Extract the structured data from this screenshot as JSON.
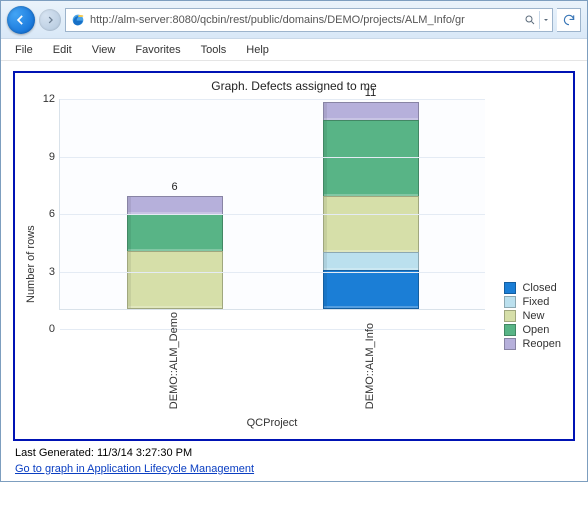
{
  "browser": {
    "url": "http://alm-server:8080/qcbin/rest/public/domains/DEMO/projects/ALM_Info/gr",
    "menu": {
      "file": "File",
      "edit": "Edit",
      "view": "View",
      "favorites": "Favorites",
      "tools": "Tools",
      "help": "Help"
    }
  },
  "chart_data": {
    "type": "bar",
    "title": "Graph. Defects assigned to me",
    "xlabel": "QCProject",
    "ylabel": "Number of rows",
    "ylim": [
      0,
      12
    ],
    "yticks": [
      0,
      3,
      6,
      9,
      12
    ],
    "categories": [
      "DEMO::ALM_Demo",
      "DEMO::ALM_Info"
    ],
    "stacked": true,
    "series": [
      {
        "name": "Closed",
        "color": "#1b7ed6",
        "values": [
          0,
          2
        ]
      },
      {
        "name": "Fixed",
        "color": "#bbe0ee",
        "values": [
          0,
          1
        ]
      },
      {
        "name": "New",
        "color": "#d6dfa9",
        "values": [
          3,
          3
        ]
      },
      {
        "name": "Open",
        "color": "#58b486",
        "values": [
          2,
          4
        ]
      },
      {
        "name": "Reopen",
        "color": "#b6b0db",
        "values": [
          1,
          1
        ]
      }
    ],
    "totals": [
      6,
      11
    ]
  },
  "footer": {
    "timestamp": "Last Generated: 11/3/14 3:27:30 PM",
    "link_label": "Go to graph in Application Lifecycle Management"
  }
}
